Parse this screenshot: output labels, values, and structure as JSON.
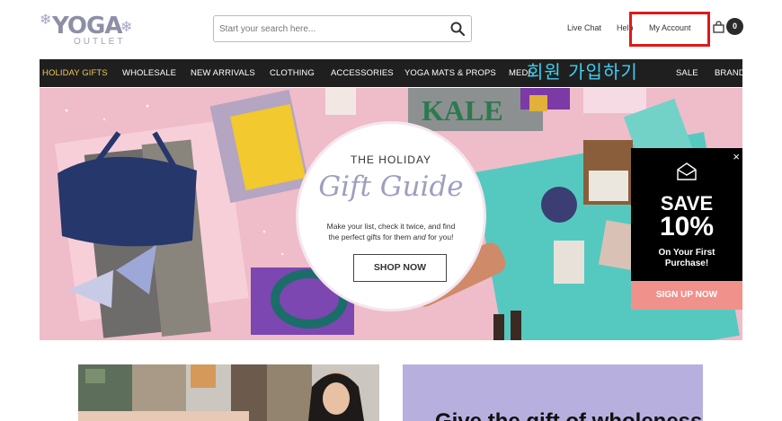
{
  "header": {
    "logo": {
      "name": "YOGA",
      "sub": "OUTLET"
    },
    "search": {
      "placeholder": "Start your search here...",
      "value": ""
    },
    "links": {
      "live_chat": "Live Chat",
      "help": "Help",
      "my_account": "My Account"
    },
    "cart_count": "0"
  },
  "nav": {
    "items": [
      "HOLIDAY GIFTS",
      "WHOLESALE",
      "NEW ARRIVALS",
      "CLOTHING",
      "ACCESSORIES",
      "YOGA MATS & PROPS",
      "MEDI",
      "SALE",
      "BRAND"
    ]
  },
  "overlay_text": "회원 가입하기",
  "hero": {
    "background_text": "KALE",
    "gift_guide": {
      "title_top": "THE HOLIDAY",
      "title_script": "Gift Guide",
      "body_line1": "Make your list, check it twice, and find",
      "body_line2_pre": "the perfect gifts for them ",
      "body_line2_em": "and",
      "body_line2_post": " for you!",
      "button": "SHOP NOW"
    }
  },
  "popup": {
    "save": "SAVE",
    "percent": "10%",
    "offer_line1": "On Your First",
    "offer_line2": "Purchase!",
    "cta": "SIGN UP NOW",
    "close": "×"
  },
  "promo_right": {
    "text": "Give the gift of wholeness"
  },
  "colors": {
    "nav_bg": "#1f1f1f",
    "nav_highlight": "#f0c75a",
    "hero_bg": "#efbcc9",
    "popup_cta": "#f1918c",
    "highlight_box": "#e01818",
    "overlay_text": "#3fd0f2"
  }
}
